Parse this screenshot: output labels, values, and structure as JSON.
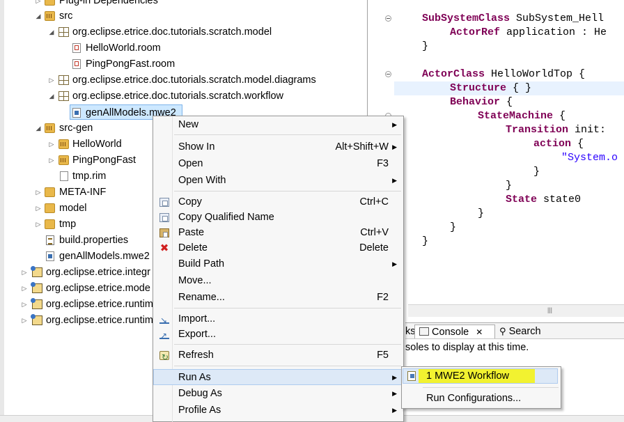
{
  "explorer": {
    "rows": [
      {
        "label": "Plug-in Dependencies",
        "twisty": "▷",
        "icon": "library-icon"
      },
      {
        "label": "src",
        "twisty": "◢",
        "icon": "source-folder-icon"
      },
      {
        "label": "org.eclipse.etrice.doc.tutorials.scratch.model",
        "twisty": "◢",
        "icon": "package-icon"
      },
      {
        "label": "HelloWorld.room",
        "twisty": "",
        "icon": "room-file-icon"
      },
      {
        "label": "PingPongFast.room",
        "twisty": "",
        "icon": "room-file-icon"
      },
      {
        "label": "org.eclipse.etrice.doc.tutorials.scratch.model.diagrams",
        "twisty": "▷",
        "icon": "package-icon"
      },
      {
        "label": "org.eclipse.etrice.doc.tutorials.scratch.workflow",
        "twisty": "◢",
        "icon": "package-icon"
      },
      {
        "label": "genAllModels.mwe2",
        "twisty": "",
        "icon": "mwe2-file-icon"
      },
      {
        "label": "src-gen",
        "twisty": "◢",
        "icon": "source-folder-icon"
      },
      {
        "label": "HelloWorld",
        "twisty": "▷",
        "icon": "package-icon"
      },
      {
        "label": "PingPongFast",
        "twisty": "▷",
        "icon": "package-icon"
      },
      {
        "label": "tmp.rim",
        "twisty": "",
        "icon": "file-icon"
      },
      {
        "label": "META-INF",
        "twisty": "▷",
        "icon": "folder-icon"
      },
      {
        "label": "model",
        "twisty": "▷",
        "icon": "folder-icon"
      },
      {
        "label": "tmp",
        "twisty": "▷",
        "icon": "folder-icon"
      },
      {
        "label": "build.properties",
        "twisty": "",
        "icon": "properties-file-icon"
      },
      {
        "label": "genAllModels.mwe2",
        "twisty": "",
        "icon": "mwe2-file-icon"
      },
      {
        "label": "org.eclipse.etrice.integr",
        "twisty": "▷",
        "icon": "plugin-project-icon"
      },
      {
        "label": "org.eclipse.etrice.mode",
        "twisty": "▷",
        "icon": "plugin-project-icon"
      },
      {
        "label": "org.eclipse.etrice.runtim",
        "twisty": "▷",
        "icon": "plugin-project-icon"
      },
      {
        "label": "org.eclipse.etrice.runtim",
        "twisty": "▷",
        "icon": "plugin-project-icon"
      }
    ]
  },
  "editor": {
    "lines": [
      {
        "kw": "SubSystemClass",
        "rest": " SubSystem_Hell"
      },
      {
        "kw": "ActorRef",
        "rest": " application : He"
      },
      {
        "kw": "",
        "rest": "}"
      },
      {
        "kw": "",
        "rest": ""
      },
      {
        "kw": "ActorClass",
        "rest": " HelloWorldTop {"
      },
      {
        "kw": "Structure",
        "rest": " { }"
      },
      {
        "kw": "Behavior",
        "rest": " {"
      },
      {
        "kw": "StateMachine",
        "rest": " {"
      },
      {
        "kw": "Transition",
        "rest": " init:"
      },
      {
        "kw": "action",
        "rest": " {"
      },
      {
        "kw": "",
        "rest": "\"System.o",
        "string": true
      },
      {
        "kw": "",
        "rest": "}"
      },
      {
        "kw": "",
        "rest": "}"
      },
      {
        "kw": "State",
        "rest": " state0"
      },
      {
        "kw": "",
        "rest": "}"
      },
      {
        "kw": "",
        "rest": "}"
      },
      {
        "kw": "",
        "rest": "}"
      }
    ]
  },
  "console": {
    "tab_prefix": "ks",
    "console_tab": "Console",
    "search_tab": "Search",
    "message": "soles to display at this time."
  },
  "context_menu": {
    "new": {
      "label": "New"
    },
    "show_in": {
      "label": "Show In",
      "shortcut": "Alt+Shift+W"
    },
    "open": {
      "label": "Open",
      "shortcut": "F3"
    },
    "open_with": {
      "label": "Open With"
    },
    "copy": {
      "label": "Copy",
      "shortcut": "Ctrl+C"
    },
    "copy_qualified": {
      "label": "Copy Qualified Name"
    },
    "paste": {
      "label": "Paste",
      "shortcut": "Ctrl+V"
    },
    "delete": {
      "label": "Delete",
      "shortcut": "Delete"
    },
    "build_path": {
      "label": "Build Path"
    },
    "move": {
      "label": "Move..."
    },
    "rename": {
      "label": "Rename...",
      "shortcut": "F2"
    },
    "import": {
      "label": "Import..."
    },
    "export": {
      "label": "Export..."
    },
    "refresh": {
      "label": "Refresh",
      "shortcut": "F5"
    },
    "run_as": {
      "label": "Run As"
    },
    "debug_as": {
      "label": "Debug As"
    },
    "profile_as": {
      "label": "Profile As"
    }
  },
  "submenu": {
    "mwe2_workflow": "1 MWE2 Workflow",
    "run_configurations": "Run Configurations..."
  },
  "colors": {
    "keyword": "#7f0055",
    "string": "#2a00ff",
    "selection": "#cde8ff",
    "highlight": "#f2f230"
  }
}
